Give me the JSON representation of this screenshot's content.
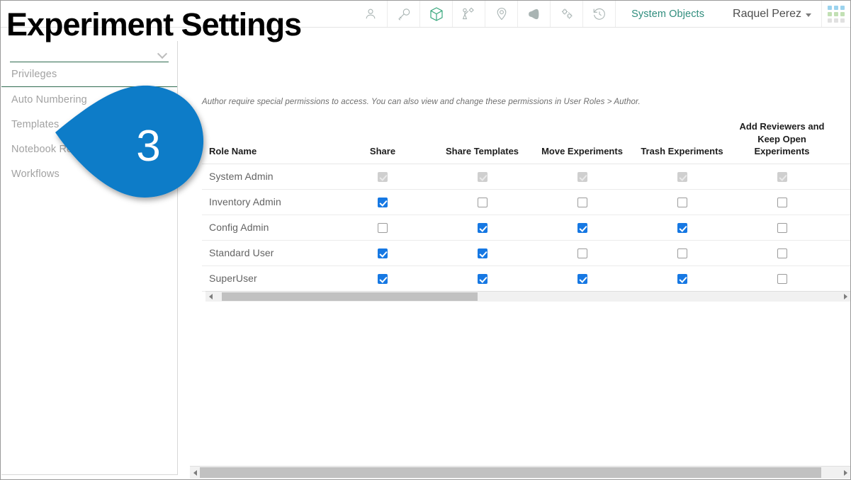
{
  "window": {
    "title": "Experiment Settings"
  },
  "header": {
    "icons": [
      {
        "name": "user-icon",
        "label": "User"
      },
      {
        "name": "key-icon",
        "label": "Key"
      },
      {
        "name": "cube-icon",
        "label": "Objects"
      },
      {
        "name": "workflow-icon",
        "label": "Workflow"
      },
      {
        "name": "location-pin-icon",
        "label": "Location"
      },
      {
        "name": "announcement-icon",
        "label": "Announcements"
      },
      {
        "name": "gears-icon",
        "label": "Configuration"
      },
      {
        "name": "history-icon",
        "label": "History"
      }
    ],
    "system_objects_label": "System Objects",
    "user_name": "Raquel Perez",
    "accent_teal": "#2f8d7d",
    "grid_dot_colors": [
      "#9bd3ee",
      "#9bd3ee",
      "#9bd3ee",
      "#c2e0b4",
      "#c2e0b4",
      "#c2e0b4",
      "#e0e0e0",
      "#e0e0e0",
      "#e0e0e0"
    ]
  },
  "sidebar": {
    "select_value": "",
    "items": [
      {
        "label": "Privileges"
      },
      {
        "label": "Auto Numbering"
      },
      {
        "label": "Templates"
      },
      {
        "label": "Notebook Requirements"
      },
      {
        "label": "Workflows"
      }
    ]
  },
  "main": {
    "note": "Author require special permissions to access. You can also view and change these permissions in User Roles > Author."
  },
  "table": {
    "columns": [
      "Role Name",
      "Share",
      "Share Templates",
      "Move Experiments",
      "Trash Experiments",
      "Add Reviewers and Keep Open Experiments",
      "",
      ""
    ],
    "rows": [
      {
        "role": "System Admin",
        "values": [
          "disabled",
          "disabled",
          "disabled",
          "disabled",
          "disabled",
          "disabled",
          "disabled"
        ]
      },
      {
        "role": "Inventory Admin",
        "values": [
          "on",
          "off",
          "off",
          "off",
          "off",
          "off",
          "off"
        ]
      },
      {
        "role": "Config Admin",
        "values": [
          "off",
          "on",
          "on",
          "on",
          "off",
          "on",
          "on"
        ]
      },
      {
        "role": "Standard User",
        "values": [
          "on",
          "on",
          "off",
          "off",
          "off",
          "off",
          "off"
        ]
      },
      {
        "role": "SuperUser",
        "values": [
          "on",
          "on",
          "on",
          "on",
          "off",
          "on",
          "on"
        ]
      }
    ]
  },
  "callout": {
    "number": "3",
    "color": "#0d7bc8"
  },
  "scrollbars": {
    "table": {
      "thumb_left_pct": 1,
      "thumb_width_pct": 41
    },
    "page": {
      "thumb_left_pct": 0,
      "thumb_width_pct": 97
    }
  }
}
